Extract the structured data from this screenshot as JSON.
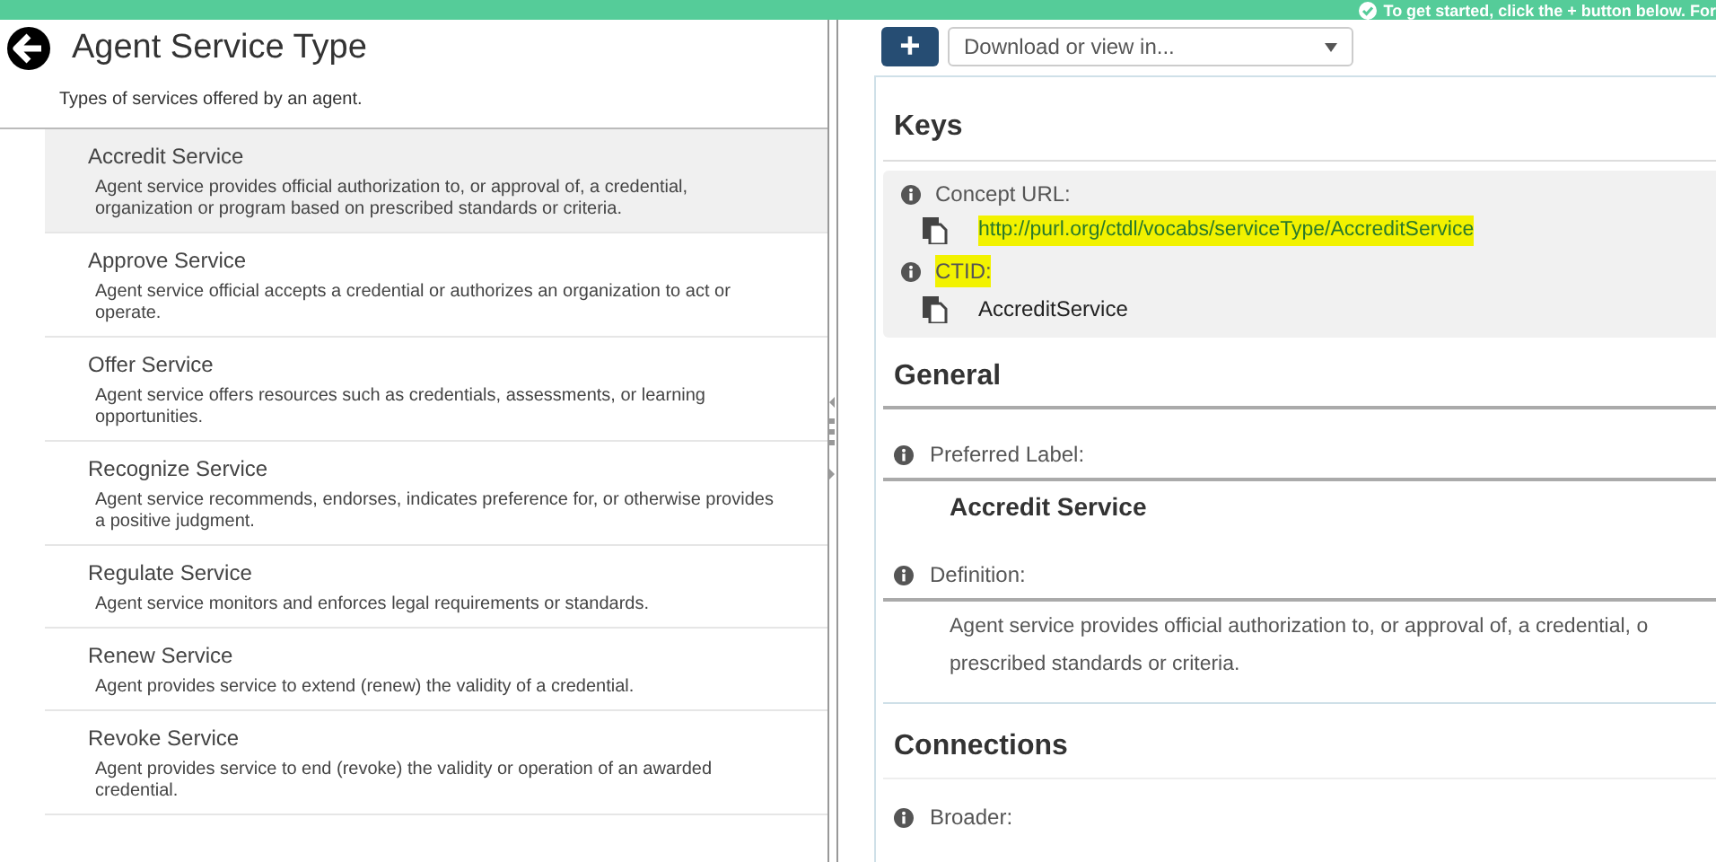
{
  "banner": {
    "text": "To get started, click the + button below. For"
  },
  "header": {
    "title": "Agent Service Type",
    "subtitle": "Types of services offered by an agent."
  },
  "services": [
    {
      "name": "Accredit Service",
      "description": "Agent service provides official authorization to, or approval of, a credential, organization or program based on prescribed standards or criteria.",
      "selected": true
    },
    {
      "name": "Approve Service",
      "description": "Agent service official accepts a credential or authorizes an organization to act or operate.",
      "selected": false
    },
    {
      "name": "Offer Service",
      "description": "Agent service offers resources such as credentials, assessments, or learning opportunities.",
      "selected": false
    },
    {
      "name": "Recognize Service",
      "description": "Agent service recommends, endorses, indicates preference for, or otherwise provides a positive judgment.",
      "selected": false
    },
    {
      "name": "Regulate Service",
      "description": "Agent service monitors and enforces legal requirements or standards.",
      "selected": false
    },
    {
      "name": "Renew Service",
      "description": "Agent provides service to extend (renew) the validity of a credential.",
      "selected": false
    },
    {
      "name": "Revoke Service",
      "description": "Agent provides service to end (revoke) the validity or operation of an awarded credential.",
      "selected": false
    }
  ],
  "toolbar": {
    "add_button": "+",
    "download_select": "Download or view in..."
  },
  "keys": {
    "title": "Keys",
    "fields": [
      {
        "label": "Concept URL:",
        "value": "http://purl.org/ctdl/vocabs/serviceType/AccreditService",
        "kind": "link",
        "label_highlighted": false,
        "value_highlighted": true
      },
      {
        "label": "CTID:",
        "value": "AccreditService",
        "kind": "text",
        "label_highlighted": true,
        "value_highlighted": false
      }
    ]
  },
  "general": {
    "title": "General",
    "preferred_label": {
      "label": "Preferred Label:",
      "value": "Accredit Service"
    },
    "definition": {
      "label": "Definition:",
      "lines": [
        "Agent service provides official authorization to, or approval of, a credential, o",
        "prescribed standards or criteria."
      ]
    }
  },
  "connections": {
    "title": "Connections",
    "fields": [
      {
        "label": "Broader:"
      }
    ]
  }
}
